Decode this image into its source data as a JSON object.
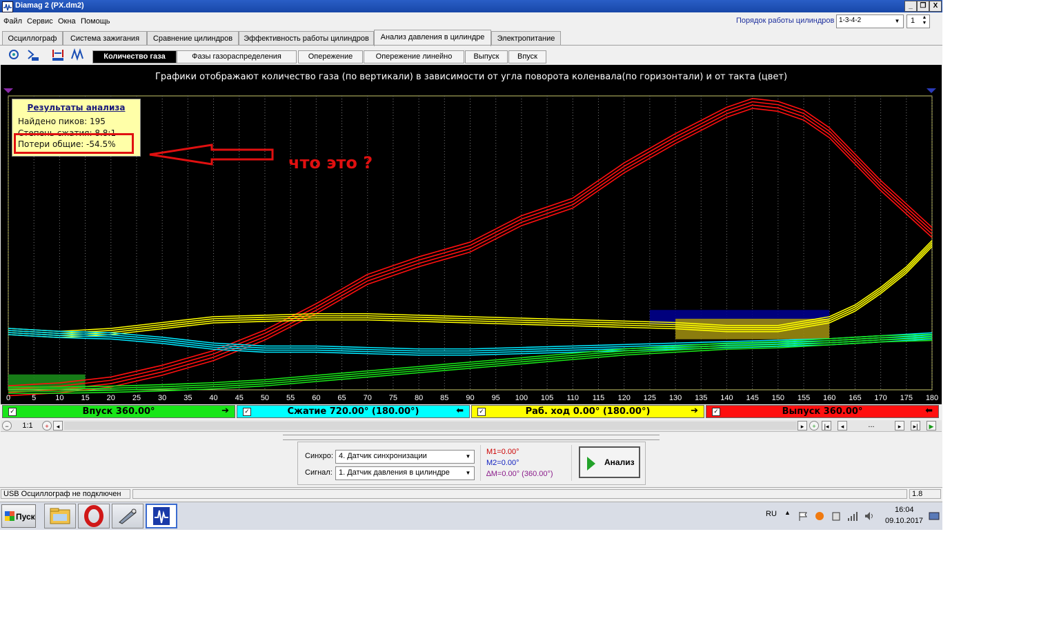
{
  "window": {
    "title": "Diamag 2 (PX.dm2)",
    "min_glyph": "_",
    "restore_glyph": "❐",
    "close_glyph": "X"
  },
  "menu": [
    "Файл",
    "Сервис",
    "Окна",
    "Помощь"
  ],
  "cylinder_order": {
    "label": "Порядок работы цилиндров",
    "value": "1-3-4-2",
    "index_value": "1"
  },
  "tabs": [
    {
      "label": "Осциллограф",
      "active": false
    },
    {
      "label": "Система зажигания",
      "active": false
    },
    {
      "label": "Сравнение цилиндров",
      "active": false
    },
    {
      "label": "Эффективность работы цилиндров",
      "active": false
    },
    {
      "label": "Анализ давления в цилиндре",
      "active": true
    },
    {
      "label": "Электропитание",
      "active": false
    }
  ],
  "toolbar_icons": [
    "sync-icon",
    "numbering-1234-icon",
    "auto-scale-icon",
    "peaks-icon"
  ],
  "subtabs": [
    {
      "label": "Количество газа",
      "active": true
    },
    {
      "label": "Фазы газораспределения",
      "active": false
    },
    {
      "label": "Опережение",
      "active": false
    },
    {
      "label": "Опережение линейно",
      "active": false
    },
    {
      "label": "Выпуск",
      "active": false
    },
    {
      "label": "Впуск",
      "active": false
    }
  ],
  "chart_caption": "Графики отображают количество газа (по вертикали) в зависимости от угла поворота коленвала(по горизонтали) и от такта (цвет)",
  "results": {
    "title": "Результаты анализа",
    "peaks": "Найдено пиков: 195",
    "compression": "Степень сжатия: 8.8:1",
    "losses": "Потери общие: -54.5%"
  },
  "annotation": "что это ?",
  "chart_data": {
    "type": "line",
    "x_ticks": [
      0,
      5,
      10,
      15,
      20,
      25,
      30,
      35,
      40,
      45,
      50,
      55,
      60,
      65,
      70,
      75,
      80,
      85,
      90,
      95,
      100,
      105,
      110,
      115,
      120,
      125,
      130,
      135,
      140,
      145,
      150,
      155,
      160,
      165,
      170,
      175,
      180
    ],
    "xlim": [
      0,
      180
    ],
    "ylim": [
      0,
      100
    ],
    "grid": "vertical dotted",
    "series": [
      {
        "color": "#ff1010",
        "x": [
          0,
          10,
          20,
          30,
          40,
          50,
          60,
          70,
          80,
          90,
          100,
          110,
          120,
          130,
          140,
          145,
          150,
          155,
          160,
          170,
          180
        ],
        "y": [
          0,
          1,
          3,
          7,
          12,
          19,
          28,
          38,
          44,
          49,
          58,
          64,
          76,
          86,
          95,
          98,
          97,
          94,
          88,
          70,
          54
        ]
      },
      {
        "color": "#ffff00",
        "x": [
          0,
          10,
          20,
          30,
          40,
          50,
          60,
          70,
          80,
          90,
          100,
          110,
          120,
          130,
          140,
          150,
          160,
          165,
          170,
          175,
          180
        ],
        "y": [
          20,
          19,
          20,
          22,
          24,
          24.5,
          25,
          25,
          24.5,
          24,
          23.5,
          23,
          22.5,
          22,
          21,
          21,
          24,
          28,
          34,
          41,
          50
        ]
      },
      {
        "color": "#00e8ff",
        "x": [
          0,
          10,
          20,
          30,
          40,
          50,
          60,
          70,
          80,
          90,
          100,
          110,
          120,
          130,
          140,
          150,
          160,
          170,
          180
        ],
        "y": [
          20,
          19,
          18.5,
          17,
          15,
          14,
          14,
          13.5,
          13,
          13,
          13.5,
          14,
          14.5,
          15,
          15.5,
          16,
          16.5,
          17.5,
          18.5
        ]
      },
      {
        "color": "#19e619",
        "x": [
          0,
          10,
          20,
          30,
          40,
          50,
          60,
          70,
          80,
          90,
          100,
          110,
          120,
          130,
          140,
          150,
          160,
          170,
          180
        ],
        "y": [
          0,
          0,
          0.3,
          0.8,
          1.5,
          2.5,
          4,
          5.5,
          7,
          8.5,
          10,
          11.5,
          13,
          14,
          15,
          15.5,
          16.5,
          17.5,
          18
        ]
      }
    ],
    "fill_regions": [
      {
        "color": "#1a8a1a",
        "x0": 0,
        "x1": 15,
        "y0": 0,
        "y1": 5
      },
      {
        "color": "#00008b",
        "x0": 125,
        "x1": 160,
        "y0": 22,
        "y1": 27
      },
      {
        "color": "#9a8a10",
        "x0": 130,
        "x1": 160,
        "y0": 17,
        "y1": 24
      }
    ]
  },
  "strokes": [
    {
      "label": "Впуск 360.00°",
      "color": "#19e619",
      "arrow": "➔",
      "checked": "✓"
    },
    {
      "label": "Сжатие 720.00° (180.00°)",
      "color": "#00ffff",
      "arrow": "⬅",
      "checked": "✓"
    },
    {
      "label": "Раб. ход 0.00° (180.00°)",
      "color": "#ffff00",
      "arrow": "➔",
      "checked": "✓"
    },
    {
      "label": "Выпуск 360.00°",
      "color": "#ff1010",
      "arrow": "⬅",
      "checked": "✓"
    }
  ],
  "scroll": {
    "zoom": "1:1",
    "ellipsis": "...",
    "btn_zoom_out": "−",
    "btn_zoom_in": "+",
    "btn_left": "◂",
    "btn_right": "▸",
    "btn_zoom_fit": "+",
    "btn_first": "|◂",
    "btn_prev": "◂",
    "btn_next": "▸",
    "btn_last": "▸|",
    "btn_play": "▶"
  },
  "bottom_panel": {
    "sync_label": "Синхро:",
    "sync_value": "4.  Датчик синхронизации",
    "signal_label": "Сигнал:",
    "signal_value": "1.  Датчик давления в цилиндре",
    "m1": "M1=0.00°",
    "m2": "M2=0.00°",
    "dm": "∆M=0.00° (360.00°)",
    "m1_color": "#cc0000",
    "m2_color": "#1020c0",
    "dm_color": "#8a1a8a",
    "analyze": "Анализ"
  },
  "status": {
    "usb": "USB Осциллограф не подключен",
    "version": "1.8"
  },
  "taskbar": {
    "start": "Пуск",
    "apps": [
      "explorer-icon",
      "opera-icon",
      "app-icon",
      "diamag-icon"
    ],
    "lang": "RU",
    "time": "16:04",
    "date": "09.10.2017"
  }
}
